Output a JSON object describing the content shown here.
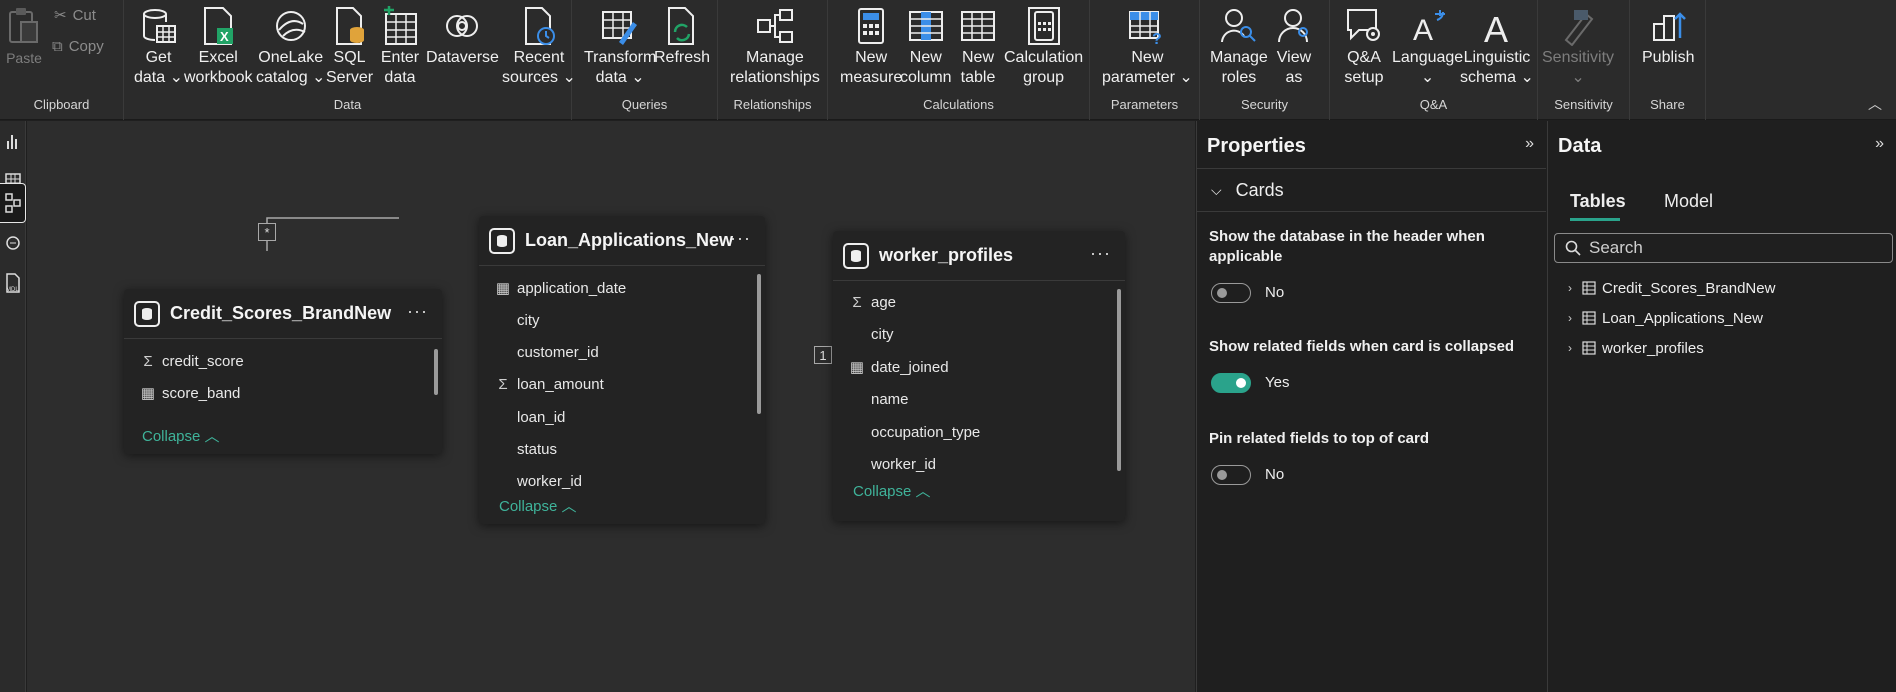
{
  "ribbon": {
    "clipboard": {
      "label": "Clipboard",
      "paste": "Paste",
      "cut": "Cut",
      "copy": "Copy"
    },
    "data": {
      "label": "Data",
      "get_data": [
        "Get",
        "data"
      ],
      "excel": [
        "Excel",
        "workbook"
      ],
      "onelake": [
        "OneLake",
        "catalog"
      ],
      "sql": [
        "SQL",
        "Server"
      ],
      "enter": [
        "Enter",
        "data"
      ],
      "dataverse": "Dataverse",
      "recent": [
        "Recent",
        "sources"
      ]
    },
    "queries": {
      "label": "Queries",
      "transform": [
        "Transform",
        "data"
      ],
      "refresh": "Refresh"
    },
    "relationships": {
      "label": "Relationships",
      "manage": [
        "Manage",
        "relationships"
      ]
    },
    "calculations": {
      "label": "Calculations",
      "new_measure": [
        "New",
        "measure"
      ],
      "new_column": [
        "New",
        "column"
      ],
      "new_table": [
        "New",
        "table"
      ],
      "calc_group": [
        "Calculation",
        "group"
      ]
    },
    "parameters": {
      "label": "Parameters",
      "new_param": [
        "New",
        "parameter"
      ]
    },
    "security": {
      "label": "Security",
      "manage_roles": [
        "Manage",
        "roles"
      ],
      "view_as": [
        "View",
        "as"
      ]
    },
    "qa": {
      "label": "Q&A",
      "qa_setup": [
        "Q&A",
        "setup"
      ],
      "language": "Language",
      "linguistic": [
        "Linguistic",
        "schema"
      ]
    },
    "sensitivity": {
      "label": "Sensitivity",
      "btn": "Sensitivity"
    },
    "share": {
      "label": "Share",
      "publish": "Publish"
    }
  },
  "tables": [
    {
      "name": "Credit_Scores_BrandNew",
      "fields": [
        {
          "name": "credit_score",
          "icon": "sigma-icon"
        },
        {
          "name": "score_band",
          "icon": "calc-column-icon"
        }
      ],
      "collapse": "Collapse"
    },
    {
      "name": "Loan_Applications_New",
      "fields": [
        {
          "name": "application_date",
          "icon": "calendar-icon"
        },
        {
          "name": "city",
          "icon": ""
        },
        {
          "name": "customer_id",
          "icon": ""
        },
        {
          "name": "loan_amount",
          "icon": "sigma-icon"
        },
        {
          "name": "loan_id",
          "icon": ""
        },
        {
          "name": "status",
          "icon": ""
        },
        {
          "name": "worker_id",
          "icon": ""
        }
      ],
      "collapse": "Collapse"
    },
    {
      "name": "worker_profiles",
      "fields": [
        {
          "name": "age",
          "icon": "sigma-icon"
        },
        {
          "name": "city",
          "icon": ""
        },
        {
          "name": "date_joined",
          "icon": "calendar-icon"
        },
        {
          "name": "name",
          "icon": ""
        },
        {
          "name": "occupation_type",
          "icon": ""
        },
        {
          "name": "worker_id",
          "icon": ""
        }
      ],
      "collapse": "Collapse"
    }
  ],
  "relationships": {
    "one": "1",
    "many": "*"
  },
  "properties": {
    "title": "Properties",
    "section": "Cards",
    "opt1": {
      "label": "Show the database in the header when applicable",
      "state": "No",
      "on": false
    },
    "opt2": {
      "label": "Show related fields when card is collapsed",
      "state": "Yes",
      "on": true
    },
    "opt3": {
      "label": "Pin related fields to top of card",
      "state": "No",
      "on": false
    }
  },
  "datapane": {
    "title": "Data",
    "tab_tables": "Tables",
    "tab_model": "Model",
    "search_placeholder": "Search",
    "items": [
      "Credit_Scores_BrandNew",
      "Loan_Applications_New",
      "worker_profiles"
    ]
  },
  "colors": {
    "accent": "#2aa38b",
    "link": "#3fb39a",
    "excel": "#21a366",
    "blue": "#3b8ee8"
  }
}
